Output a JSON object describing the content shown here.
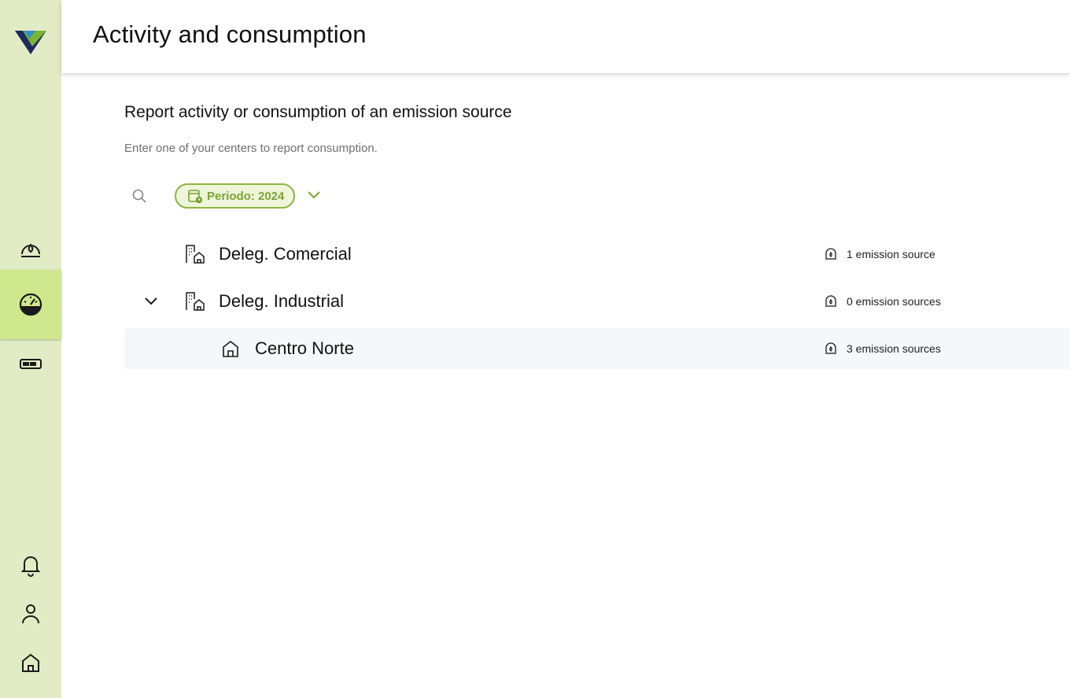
{
  "header": {
    "title": "Activity and consumption"
  },
  "main": {
    "title": "Report activity or consumption of an emission source",
    "subtitle": "Enter one of your centers to report consumption.",
    "period_filter": {
      "label": "Periodo: 2024"
    },
    "centers": [
      {
        "name": "Deleg. Comercial",
        "sources": "1 emission source",
        "icon": "building-home-icon"
      },
      {
        "name": "Deleg. Industrial",
        "sources": "0 emission sources",
        "icon": "building-home-icon",
        "expanded": true
      },
      {
        "name": "Centro Norte",
        "sources": "3 emission sources",
        "icon": "home-icon",
        "parent": "Deleg. Industrial"
      }
    ]
  },
  "sidebar": {
    "items": [
      {
        "icon": "emission-source-icon"
      },
      {
        "icon": "dashboard-gauge-icon",
        "active": true
      },
      {
        "icon": "battery-icon"
      },
      {
        "icon": "bell-icon"
      },
      {
        "icon": "user-icon"
      },
      {
        "icon": "home-icon"
      }
    ]
  },
  "colors": {
    "sidebar_bg": "#e2ecc4",
    "sidebar_active": "#cfe88d",
    "accent": "#8db640",
    "row_highlight": "#f4f8fa"
  }
}
